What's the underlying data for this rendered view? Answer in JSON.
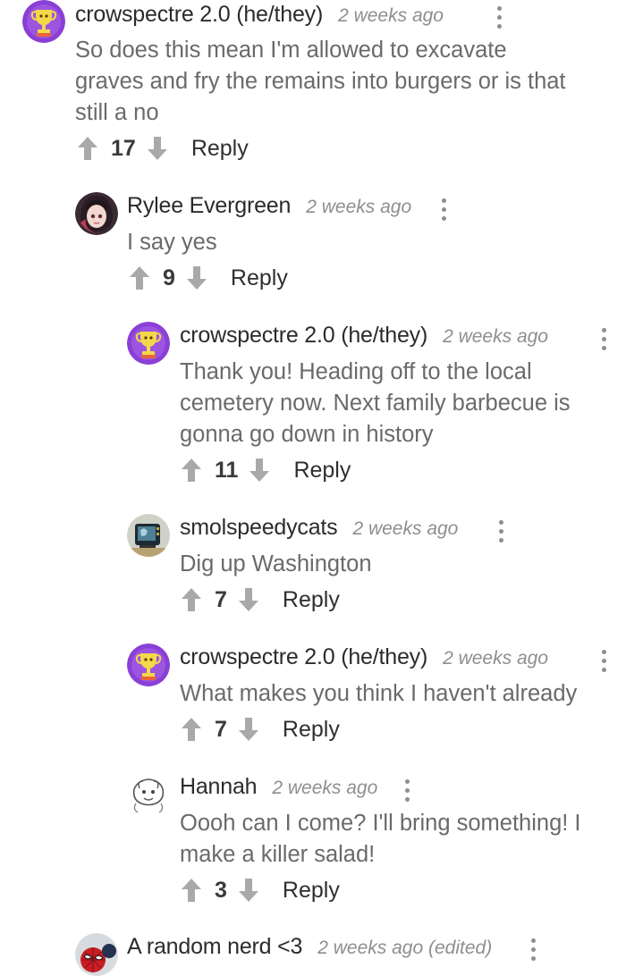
{
  "comments": [
    {
      "author": "crowspectre 2.0 (he/they)",
      "time": "2 weeks ago",
      "text": "So does this mean I'm allowed to excavate\ngraves and fry the remains into burgers or is that\nstill a no",
      "votes": "17",
      "reply_label": "Reply",
      "avatar_icon": "trophy-avatar-icon"
    },
    {
      "author": "Rylee Evergreen",
      "time": "2 weeks ago",
      "text": "I say yes",
      "votes": "9",
      "reply_label": "Reply",
      "avatar_icon": "anime-girl-avatar-icon"
    },
    {
      "author": "crowspectre 2.0 (he/they)",
      "time": "2 weeks ago",
      "text": "Thank you! Heading off to the local\ncemetery now. Next family barbecue is\ngonna go down in history",
      "votes": "11",
      "reply_label": "Reply",
      "avatar_icon": "trophy-avatar-icon"
    },
    {
      "author": "smolspeedycats",
      "time": "2 weeks ago",
      "text": "Dig up Washington",
      "votes": "7",
      "reply_label": "Reply",
      "avatar_icon": "pixel-tv-avatar-icon"
    },
    {
      "author": "crowspectre 2.0 (he/they)",
      "time": "2 weeks ago",
      "text": "What makes you think I haven't already",
      "votes": "7",
      "reply_label": "Reply",
      "avatar_icon": "trophy-avatar-icon"
    },
    {
      "author": "Hannah",
      "time": "2 weeks ago",
      "text": "Oooh can I come? I'll bring something! I\nmake a killer salad!",
      "votes": "3",
      "reply_label": "Reply",
      "avatar_icon": "sketch-avatar-icon"
    },
    {
      "author": "A random nerd <3",
      "time": "2 weeks ago (edited)",
      "text": "",
      "votes": "",
      "reply_label": "",
      "avatar_icon": "spiderman-avatar-icon"
    }
  ],
  "colors": {
    "author": "#2b2b2b",
    "meta": "#8e8e8e",
    "body_text": "#6a6a6a",
    "vote_arrow": "#a9a9a9",
    "trophy_avatar_bg": "#8a3fd6"
  }
}
